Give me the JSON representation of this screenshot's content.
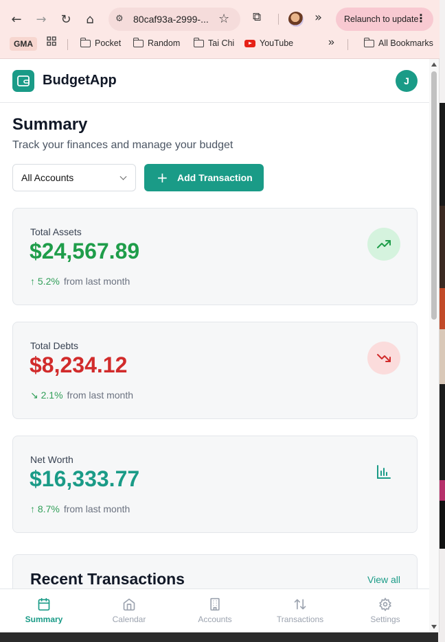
{
  "browser": {
    "url": "80caf93a-2999-...",
    "relaunch_label": "Relaunch to update",
    "bookmarks": [
      {
        "label": "GMA"
      },
      {
        "label": "Pocket"
      },
      {
        "label": "Random"
      },
      {
        "label": "Tai Chi"
      },
      {
        "label": "YouTube"
      },
      {
        "label": "All Bookmarks"
      }
    ]
  },
  "app": {
    "name": "BudgetApp",
    "user_initial": "J"
  },
  "summary": {
    "title": "Summary",
    "subtitle": "Track your finances and manage your budget",
    "account_select": "All Accounts",
    "add_button": "Add Transaction"
  },
  "cards": {
    "assets": {
      "label": "Total Assets",
      "value": "$24,567.89",
      "change": "5.2%",
      "change_text": "from last month",
      "color": "#1f9d4a"
    },
    "debts": {
      "label": "Total Debts",
      "value": "$8,234.12",
      "change": "2.1%",
      "change_text": "from last month",
      "color": "#d12b2b"
    },
    "networth": {
      "label": "Net Worth",
      "value": "$16,333.77",
      "change": "8.7%",
      "change_text": "from last month",
      "color": "#1a9b87"
    }
  },
  "recent": {
    "title": "Recent Transactions",
    "view_all": "View all"
  },
  "bottom_nav": [
    {
      "label": "Summary",
      "icon": "calendar-icon",
      "active": true
    },
    {
      "label": "Calendar",
      "icon": "home-icon",
      "active": false
    },
    {
      "label": "Accounts",
      "icon": "building-icon",
      "active": false
    },
    {
      "label": "Transactions",
      "icon": "arrows-updown-icon",
      "active": false
    },
    {
      "label": "Settings",
      "icon": "gear-icon",
      "active": false
    }
  ],
  "colors": {
    "accent": "#1a9b87",
    "positive": "#1f9d4a",
    "negative": "#d12b2b"
  }
}
